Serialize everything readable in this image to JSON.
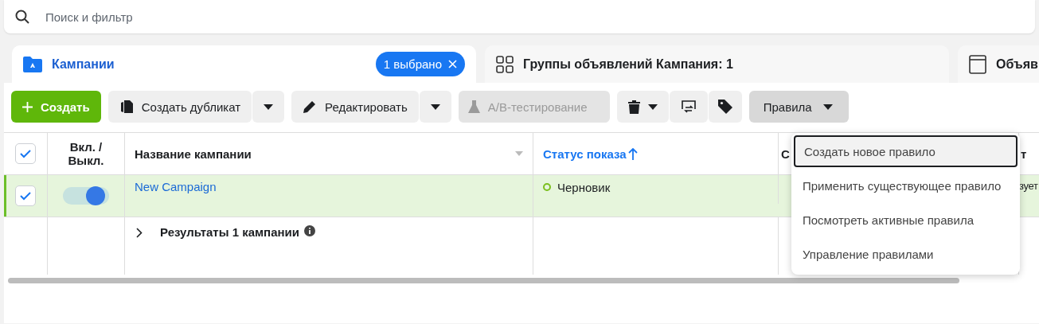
{
  "search": {
    "placeholder": "Поиск и фильтр"
  },
  "tabs": [
    {
      "label": "Кампании",
      "selected": true,
      "badge": "1 выбрано",
      "kind": "folder"
    },
    {
      "label": "Группы объявлений Кампания: 1",
      "selected": false,
      "kind": "grid"
    },
    {
      "label": "Объяв",
      "selected": false,
      "kind": "window"
    }
  ],
  "toolbar": {
    "create": "Создать",
    "duplicate": "Создать дубликат",
    "edit": "Редактировать",
    "ab_test": {
      "label": "A/B-тестирование",
      "disabled": true
    },
    "rules": "Правила"
  },
  "table": {
    "all_checked": true,
    "columns": [
      {
        "label": "Вкл. / Выкл."
      },
      {
        "label": "Название кампании"
      },
      {
        "label": "Статус показа",
        "sorted": true
      },
      {
        "label": "С"
      },
      {
        "label": "т"
      }
    ],
    "rows": [
      {
        "checked": true,
        "on": true,
        "name": "New Campaign",
        "status": "Черновик",
        "color": "#7bbf1e",
        "column_5": "зует"
      }
    ],
    "summary": "Результаты 1 кампании"
  },
  "menu": {
    "items": [
      {
        "label": "Создать новое правило",
        "selected": true
      },
      {
        "label": "Применить существующее правило",
        "selected": false
      },
      {
        "label": "Посмотреть активные правила",
        "selected": false
      },
      {
        "label": "Управление правилами",
        "selected": false
      }
    ]
  }
}
